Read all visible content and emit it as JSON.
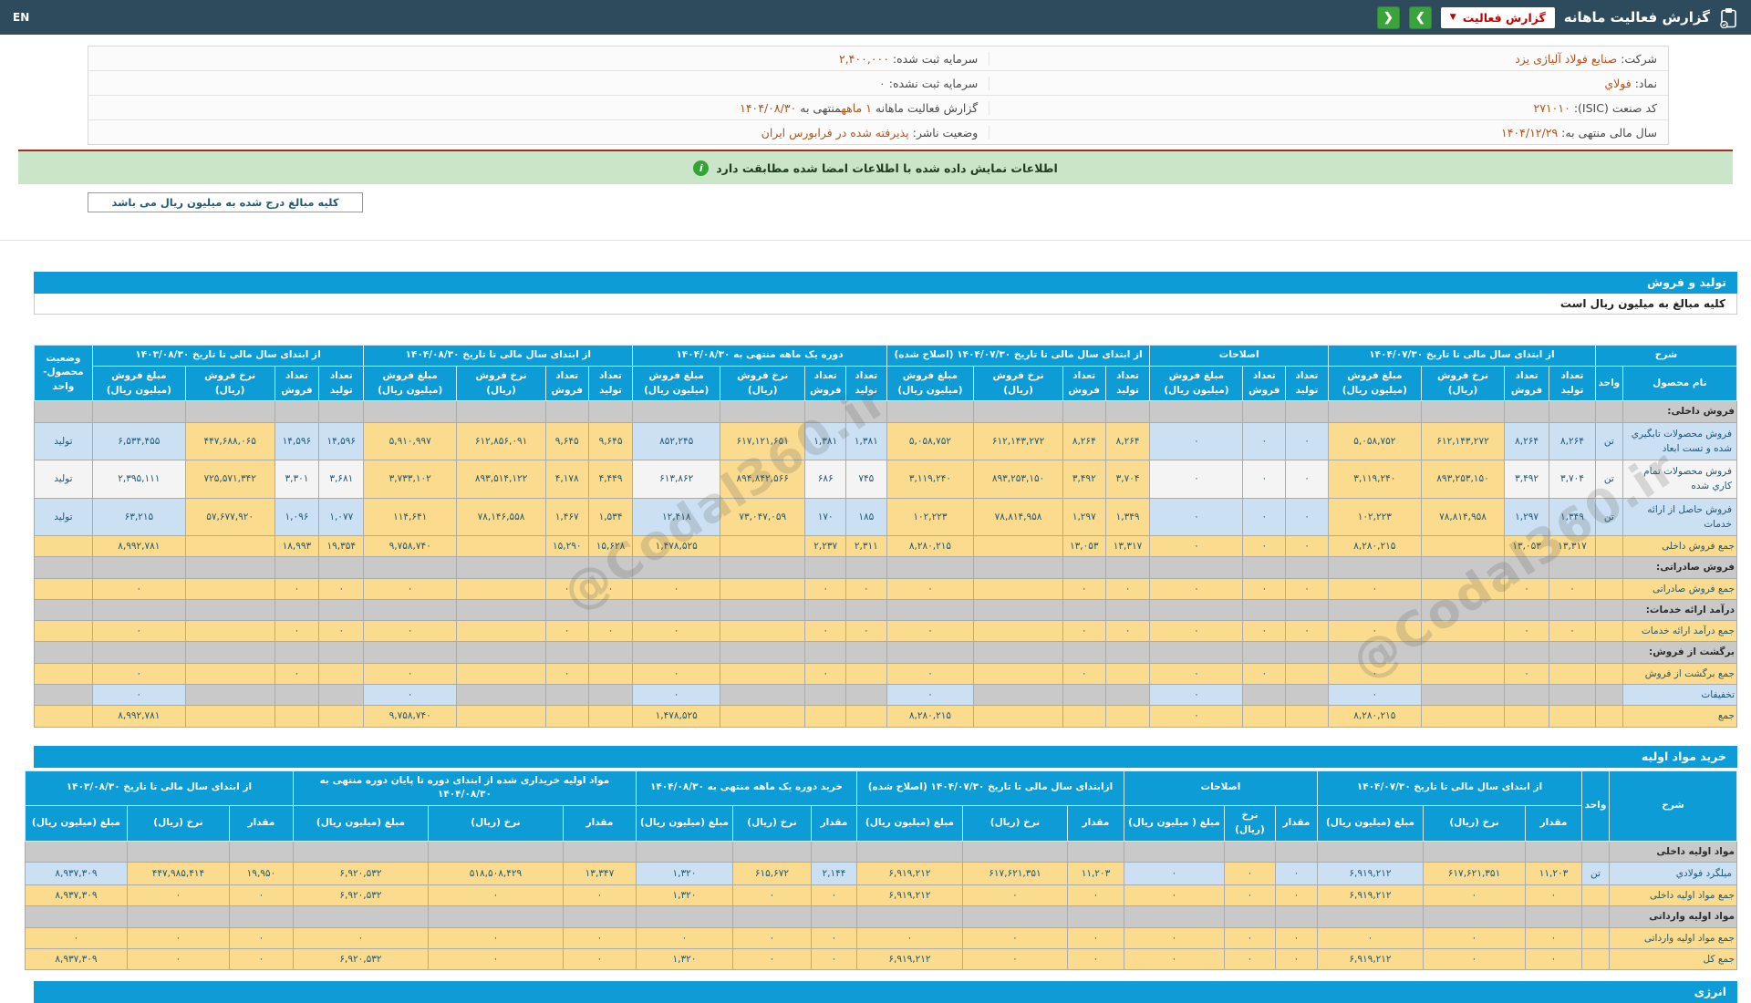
{
  "topbar": {
    "title": "گزارش فعالیت ماهانه",
    "dropdown_label": "گزارش فعالیت",
    "dropdown_caret": "▼",
    "nav_right": "❯",
    "nav_left": "❮",
    "lang": "EN"
  },
  "info": {
    "company_label": "شرکت:",
    "company_value": "صنایع فولاد آلیاژی یزد",
    "symbol_label": "نماد:",
    "symbol_value": "فولاي",
    "isic_label": "کد صنعت (ISIC):",
    "isic_value": "۲۷۱۰۱۰",
    "fiscal_label": "سال مالی منتهی به:",
    "fiscal_value": "۱۴۰۴/۱۲/۲۹",
    "capital_label": "سرمایه ثبت شده:",
    "capital_value": "۲,۴۰۰,۰۰۰",
    "unregistered_label": "سرمایه ثبت نشده:",
    "unregistered_value": "۰",
    "report_label": "گزارش فعالیت ماهانه",
    "report_period": "۱ ماهه",
    "report_mid": "منتهی به",
    "report_date": "۱۴۰۴/۰۸/۳۰",
    "status_label": "وضعیت ناشر:",
    "status_value": "پذیرفته شده در فرابورس ایران"
  },
  "notice": {
    "icon": "i",
    "text": "اطلاعات نمایش داده شده با اطلاعات امضا شده مطابقت دارد"
  },
  "million_note": "کلیه مبالغ درج شده به میلیون ریال می باشد",
  "watermark": "@Codal360.ir",
  "energy": {
    "section_title": "انرژی"
  },
  "production_sales": {
    "section_title": "تولید و فروش",
    "subtitle": "کلیه مبالغ به میلیون ریال است",
    "widths": [
      118,
      28,
      48,
      46,
      86,
      96,
      44,
      44,
      96,
      46,
      44,
      92,
      90,
      42,
      42,
      88,
      90,
      46,
      44,
      92,
      96,
      46,
      46,
      92,
      96,
      60
    ],
    "groups": [
      {
        "label": "شرح",
        "colspan": 2
      },
      {
        "label": "از ابتدای سال مالی تا تاریخ ۱۴۰۴/۰۷/۳۰",
        "colspan": 4
      },
      {
        "label": "اصلاحات",
        "colspan": 3
      },
      {
        "label": "از ابتدای سال مالی تا تاریخ ۱۴۰۴/۰۷/۳۰ (اصلاح شده)",
        "colspan": 4
      },
      {
        "label": "دوره یک ماهه منتهی به ۱۴۰۴/۰۸/۳۰",
        "colspan": 4
      },
      {
        "label": "از ابتدای سال مالی تا تاریخ ۱۴۰۴/۰۸/۳۰",
        "colspan": 4
      },
      {
        "label": "از ابتدای سال مالی تا تاریخ ۱۴۰۳/۰۸/۳۰",
        "colspan": 4
      },
      {
        "label": "وضعیت\nمحصول-واحد",
        "rowspan": 2
      }
    ],
    "subs": [
      "نام محصول",
      "واحد",
      "تعداد\nتولید",
      "تعداد\nفروش",
      "نرخ فروش\n(ریال)",
      "مبلغ فروش\n(میلیون ریال)",
      "تعداد\nتولید",
      "تعداد\nفروش",
      "مبلغ فروش\n(میلیون ریال)",
      "تعداد\nتولید",
      "تعداد\nفروش",
      "نرخ فروش\n(ریال)",
      "مبلغ فروش\n(میلیون ریال)",
      "تعداد\nتولید",
      "تعداد\nفروش",
      "نرخ فروش\n(ریال)",
      "مبلغ فروش\n(میلیون ریال)",
      "تعداد\nتولید",
      "تعداد\nفروش",
      "نرخ فروش\n(ریال)",
      "مبلغ فروش\n(میلیون ریال)",
      "تعداد\nتولید",
      "تعداد\nفروش",
      "نرخ فروش\n(ریال)",
      "مبلغ فروش\n(میلیون ریال)"
    ],
    "yellow_cols": [
      4,
      5,
      9,
      10,
      11,
      12,
      15,
      17,
      18,
      19,
      20,
      23
    ],
    "money_cols": [
      5,
      8,
      12,
      16,
      20,
      24
    ],
    "rows": [
      {
        "type": "section",
        "cells": [
          "فروش داخلی:",
          "",
          "",
          "",
          "",
          "",
          "",
          "",
          "",
          "",
          "",
          "",
          "",
          "",
          "",
          "",
          "",
          "",
          "",
          "",
          "",
          "",
          "",
          "",
          "",
          ""
        ]
      },
      {
        "type": "data",
        "stripe": "blue",
        "cells": [
          "فروش محصولات تابگيري شده و تست ابعاد",
          "تن",
          "۸,۲۶۴",
          "۸,۲۶۴",
          "۶۱۲,۱۴۳,۲۷۲",
          "۵,۰۵۸,۷۵۲",
          "۰",
          "۰",
          "۰",
          "۸,۲۶۴",
          "۸,۲۶۴",
          "۶۱۲,۱۴۳,۲۷۲",
          "۵,۰۵۸,۷۵۲",
          "۱,۳۸۱",
          "۱,۳۸۱",
          "۶۱۷,۱۲۱,۶۵۱",
          "۸۵۲,۲۴۵",
          "۹,۶۴۵",
          "۹,۶۴۵",
          "۶۱۲,۸۵۶,۰۹۱",
          "۵,۹۱۰,۹۹۷",
          "۱۴,۵۹۶",
          "۱۴,۵۹۶",
          "۴۴۷,۶۸۸,۰۶۵",
          "۶,۵۳۴,۴۵۵",
          "تولید"
        ]
      },
      {
        "type": "data",
        "stripe": "white",
        "cells": [
          "فروش محصولات تمام کاري شده",
          "تن",
          "۳,۷۰۴",
          "۳,۴۹۲",
          "۸۹۳,۲۵۳,۱۵۰",
          "۳,۱۱۹,۲۴۰",
          "۰",
          "۰",
          "۰",
          "۳,۷۰۴",
          "۳,۴۹۲",
          "۸۹۳,۲۵۳,۱۵۰",
          "۳,۱۱۹,۲۴۰",
          "۷۴۵",
          "۶۸۶",
          "۸۹۴,۸۴۲,۵۶۶",
          "۶۱۳,۸۶۲",
          "۴,۴۴۹",
          "۴,۱۷۸",
          "۸۹۳,۵۱۴,۱۲۲",
          "۳,۷۳۳,۱۰۲",
          "۳,۶۸۱",
          "۳,۳۰۱",
          "۷۲۵,۵۷۱,۳۴۲",
          "۲,۳۹۵,۱۱۱",
          "تولید"
        ]
      },
      {
        "type": "data",
        "stripe": "blue",
        "cells": [
          "فروش حاصل از ارائه خدمات",
          "تن",
          "۱,۳۴۹",
          "۱,۲۹۷",
          "۷۸,۸۱۴,۹۵۸",
          "۱۰۲,۲۲۳",
          "۰",
          "۰",
          "۰",
          "۱,۳۴۹",
          "۱,۲۹۷",
          "۷۸,۸۱۴,۹۵۸",
          "۱۰۲,۲۲۳",
          "۱۸۵",
          "۱۷۰",
          "۷۳,۰۴۷,۰۵۹",
          "۱۲,۴۱۸",
          "۱,۵۳۴",
          "۱,۴۶۷",
          "۷۸,۱۴۶,۵۵۸",
          "۱۱۴,۶۴۱",
          "۱,۰۷۷",
          "۱,۰۹۶",
          "۵۷,۶۷۷,۹۲۰",
          "۶۳,۲۱۵",
          "تولید"
        ]
      },
      {
        "type": "total",
        "cells": [
          "جمع فروش داخلی",
          "",
          "۱۳,۳۱۷",
          "۱۳,۰۵۳",
          "",
          "۸,۲۸۰,۲۱۵",
          "۰",
          "۰",
          "۰",
          "۱۳,۳۱۷",
          "۱۳,۰۵۳",
          "",
          "۸,۲۸۰,۲۱۵",
          "۲,۳۱۱",
          "۲,۲۳۷",
          "",
          "۱,۴۷۸,۵۲۵",
          "۱۵,۶۲۸",
          "۱۵,۲۹۰",
          "",
          "۹,۷۵۸,۷۴۰",
          "۱۹,۳۵۴",
          "۱۸,۹۹۳",
          "",
          "۸,۹۹۲,۷۸۱",
          ""
        ]
      },
      {
        "type": "section",
        "cells": [
          "فروش صادراتی:",
          "",
          "",
          "",
          "",
          "",
          "",
          "",
          "",
          "",
          "",
          "",
          "",
          "",
          "",
          "",
          "",
          "",
          "",
          "",
          "",
          "",
          "",
          "",
          "",
          ""
        ]
      },
      {
        "type": "total",
        "cells": [
          "جمع فروش صادراتی",
          "",
          "۰",
          "۰",
          "",
          "۰",
          "۰",
          "۰",
          "۰",
          "۰",
          "۰",
          "",
          "۰",
          "۰",
          "۰",
          "",
          "۰",
          "۰",
          "۰",
          "",
          "۰",
          "۰",
          "۰",
          "",
          "۰",
          ""
        ]
      },
      {
        "type": "section",
        "cells": [
          "درآمد ارائه خدمات:",
          "",
          "",
          "",
          "",
          "",
          "",
          "",
          "",
          "",
          "",
          "",
          "",
          "",
          "",
          "",
          "",
          "",
          "",
          "",
          "",
          "",
          "",
          "",
          "",
          ""
        ]
      },
      {
        "type": "total",
        "cells": [
          "جمع درآمد ارائه خدمات",
          "",
          "۰",
          "۰",
          "",
          "۰",
          "۰",
          "۰",
          "۰",
          "۰",
          "۰",
          "",
          "۰",
          "۰",
          "۰",
          "",
          "۰",
          "۰",
          "۰",
          "",
          "۰",
          "۰",
          "۰",
          "",
          "۰",
          ""
        ]
      },
      {
        "type": "section",
        "cells": [
          "برگشت از فروش:",
          "",
          "",
          "",
          "",
          "",
          "",
          "",
          "",
          "",
          "",
          "",
          "",
          "",
          "",
          "",
          "",
          "",
          "",
          "",
          "",
          "",
          "",
          "",
          "",
          ""
        ]
      },
      {
        "type": "total",
        "cells": [
          "جمع برگشت از فروش",
          "",
          "",
          "۰",
          "",
          "۰",
          "",
          "۰",
          "۰",
          "",
          "۰",
          "",
          "۰",
          "",
          "۰",
          "",
          "۰",
          "",
          "۰",
          "",
          "۰",
          "",
          "۰",
          "",
          "۰",
          ""
        ]
      },
      {
        "type": "discount",
        "cells": [
          "تخفیفات",
          "",
          "",
          "",
          "",
          "۰",
          "",
          "",
          "۰",
          "",
          "",
          "",
          "۰",
          "",
          "",
          "",
          "۰",
          "",
          "",
          "",
          "۰",
          "",
          "",
          "",
          "۰",
          ""
        ]
      },
      {
        "type": "total",
        "cells": [
          "جمع",
          "",
          "",
          "",
          "",
          "۸,۲۸۰,۲۱۵",
          "",
          "",
          "۰",
          "",
          "",
          "",
          "۸,۲۸۰,۲۱۵",
          "",
          "",
          "",
          "۱,۴۷۸,۵۲۵",
          "",
          "",
          "",
          "۹,۷۵۸,۷۴۰",
          "",
          "",
          "",
          "۸,۹۹۲,۷۸۱",
          ""
        ]
      }
    ]
  },
  "raw_materials": {
    "section_title": "خرید مواد اولیه",
    "widths": [
      140,
      30,
      62,
      112,
      116,
      46,
      56,
      110,
      62,
      115,
      116,
      50,
      86,
      106,
      80,
      148,
      148,
      70,
      112,
      112
    ],
    "groups": [
      {
        "label": "شرح",
        "rowspan": 2
      },
      {
        "label": "واحد",
        "rowspan": 2
      },
      {
        "label": "از ابتدای سال مالی تا تاریخ ۱۴۰۴/۰۷/۳۰",
        "colspan": 3
      },
      {
        "label": "اصلاحات",
        "colspan": 3
      },
      {
        "label": "ازابتدای سال مالی تا تاریخ ۱۴۰۴/۰۷/۳۰ (اصلاح شده)",
        "colspan": 3
      },
      {
        "label": "خرید دوره یک ماهه منتهی به ۱۴۰۴/۰۸/۳۰",
        "colspan": 3
      },
      {
        "label": "مواد اولیه خریداری شده از ابتدای دوره تا پایان دوره منتهی به ۱۴۰۴/۰۸/۳۰",
        "colspan": 3
      },
      {
        "label": "از ابتدای سال مالی تا تاریخ ۱۴۰۳/۰۸/۳۰",
        "colspan": 3
      }
    ],
    "subs": [
      "مقدار",
      "نرخ (ریال)",
      "مبلغ (میلیون ریال)",
      "مقدار",
      "نرخ (ریال)",
      "مبلغ ( میلیون ریال)",
      "مقدار",
      "نرخ (ریال)",
      "مبلغ (میلیون ریال)",
      "مقدار",
      "نرخ (ریال)",
      "مبلغ (میلیون ریال)",
      "مقدار",
      "نرخ (ریال)",
      "مبلغ (میلیون ریال)",
      "مقدار",
      "نرخ (ریال)",
      "مبلغ (میلیون ریال)"
    ],
    "yellow_cols": [
      2,
      3,
      6,
      8,
      9,
      10,
      12,
      14,
      15,
      16,
      17,
      18
    ],
    "money_cols": [
      4,
      7,
      10,
      13,
      16,
      19
    ],
    "rows": [
      {
        "type": "section",
        "cells": [
          "مواد اولیه داخلی",
          "",
          "",
          "",
          "",
          "",
          "",
          "",
          "",
          "",
          "",
          "",
          "",
          "",
          "",
          "",
          "",
          "",
          "",
          ""
        ]
      },
      {
        "type": "data",
        "stripe": "blue",
        "cells": [
          "میلگرد فولادي",
          "تن",
          "۱۱,۲۰۳",
          "۶۱۷,۶۲۱,۳۵۱",
          "۶,۹۱۹,۲۱۲",
          "۰",
          "۰",
          "۰",
          "۱۱,۲۰۳",
          "۶۱۷,۶۲۱,۳۵۱",
          "۶,۹۱۹,۲۱۲",
          "۲,۱۴۴",
          "۶۱۵,۶۷۲",
          "۱,۳۲۰",
          "۱۳,۳۴۷",
          "۵۱۸,۵۰۸,۴۲۹",
          "۶,۹۲۰,۵۳۲",
          "۱۹,۹۵۰",
          "۴۴۷,۹۸۵,۴۱۴",
          "۸,۹۳۷,۳۰۹"
        ]
      },
      {
        "type": "total",
        "cells": [
          "جمع مواد اولیه داخلی",
          "",
          "۰",
          "۰",
          "۶,۹۱۹,۲۱۲",
          "۰",
          "۰",
          "۰",
          "۰",
          "۰",
          "۶,۹۱۹,۲۱۲",
          "۰",
          "۰",
          "۱,۳۲۰",
          "۰",
          "۰",
          "۶,۹۲۰,۵۳۲",
          "۰",
          "۰",
          "۸,۹۳۷,۳۰۹"
        ]
      },
      {
        "type": "section",
        "cells": [
          "مواد اولیه وارداتی",
          "",
          "",
          "",
          "",
          "",
          "",
          "",
          "",
          "",
          "",
          "",
          "",
          "",
          "",
          "",
          "",
          "",
          "",
          ""
        ]
      },
      {
        "type": "total",
        "cells": [
          "جمع مواد اولیه وارداتی",
          "",
          "۰",
          "۰",
          "۰",
          "۰",
          "۰",
          "۰",
          "۰",
          "۰",
          "۰",
          "۰",
          "۰",
          "۰",
          "۰",
          "۰",
          "۰",
          "۰",
          "۰",
          "۰"
        ]
      },
      {
        "type": "total",
        "cells": [
          "جمع کل",
          "",
          "۰",
          "۰",
          "۶,۹۱۹,۲۱۲",
          "۰",
          "۰",
          "۰",
          "۰",
          "۰",
          "۶,۹۱۹,۲۱۲",
          "۰",
          "۰",
          "۱,۳۲۰",
          "۰",
          "۰",
          "۶,۹۲۰,۵۳۲",
          "۰",
          "۰",
          "۸,۹۳۷,۳۰۹"
        ]
      }
    ]
  }
}
